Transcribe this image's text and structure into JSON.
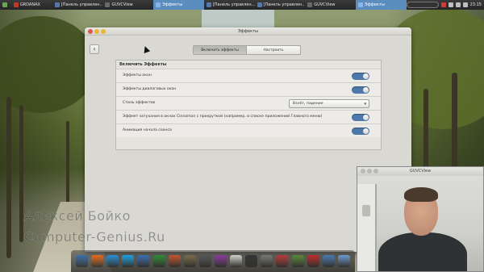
{
  "top_panel": {
    "tasks": [
      {
        "label": "GRDANAX",
        "color": "#c0392b"
      },
      {
        "label": "[Панель управлен...",
        "color": "#5577aa"
      },
      {
        "label": "GUVCView",
        "color": "#6a6a6a"
      },
      {
        "label": "Эффекты",
        "color": "#8ab4e8",
        "active": true
      },
      {
        "label": "[Панель управлен...",
        "color": "#5577aa"
      },
      {
        "label": "[Панель управлен...",
        "color": "#5577aa"
      },
      {
        "label": "GUVCView",
        "color": "#6a6a6a"
      },
      {
        "label": "Эффекты",
        "color": "#8ab4e8",
        "active": true
      }
    ],
    "clock": "23:15",
    "tray_icons": [
      "flag-icon",
      "network-icon",
      "volume-icon",
      "battery-icon"
    ]
  },
  "effects_window": {
    "title": "Эффекты",
    "back_label": "‹",
    "tabs": [
      {
        "label": "Включить эффекты",
        "active": true
      },
      {
        "label": "Настроить",
        "active": false
      }
    ],
    "section_title": "Включить Эффекты",
    "rows": [
      {
        "label": "Эффекты окон",
        "type": "toggle",
        "on": true
      },
      {
        "label": "Эффекты диалоговых окон",
        "type": "toggle",
        "on": true
      },
      {
        "label": "Стиль эффектов",
        "type": "dropdown",
        "value": "Взлёт, падение"
      },
      {
        "label": "Эффект затухания в окнах Cinnamon с прокруткой (например, в списке приложений Главного меню)",
        "type": "toggle",
        "on": true
      },
      {
        "label": "Анимация начала сеанса",
        "type": "toggle",
        "on": true
      }
    ],
    "accent": "#4c79a9"
  },
  "watermark": {
    "line1": "Алексей Бойко",
    "line2": "Computer-Genius.Ru"
  },
  "webcam_window": {
    "title": "GUVCView"
  },
  "dock": {
    "icons": [
      {
        "name": "anchor-icon",
        "color": "#3a6ea5"
      },
      {
        "name": "firefox-icon",
        "color": "#e66a1c"
      },
      {
        "name": "play-icon",
        "color": "#2a8fd6"
      },
      {
        "name": "skype-icon",
        "color": "#1aa3e8"
      },
      {
        "name": "document-icon",
        "color": "#3b6db3"
      },
      {
        "name": "spreadsheet-icon",
        "color": "#2e8b3a"
      },
      {
        "name": "presentation-icon",
        "color": "#c5552b"
      },
      {
        "name": "text-editor-icon",
        "color": "#7a6a4a"
      },
      {
        "name": "tools-icon",
        "color": "#555555"
      },
      {
        "name": "screenshot-icon",
        "color": "#8a3aa0"
      },
      {
        "name": "webcam-icon",
        "color": "#cfcfcf"
      },
      {
        "name": "terminal-icon",
        "color": "#333333"
      },
      {
        "name": "calculator-icon",
        "color": "#777777"
      },
      {
        "name": "media-icon",
        "color": "#b83a3a"
      },
      {
        "name": "archive-icon",
        "color": "#5a8a3a"
      },
      {
        "name": "recorder-icon",
        "color": "#c22a2a"
      },
      {
        "name": "settings-icon",
        "color": "#4a7ab0"
      },
      {
        "name": "files-icon",
        "color": "#6a9ad0"
      }
    ]
  }
}
